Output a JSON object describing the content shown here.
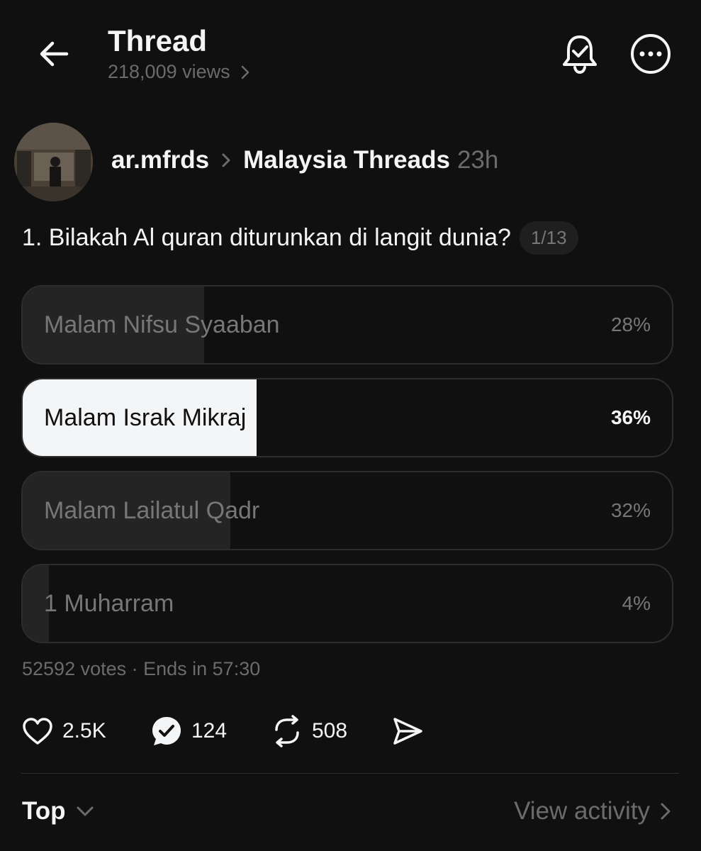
{
  "header": {
    "title": "Thread",
    "views": "218,009 views"
  },
  "post": {
    "username": "ar.mfrds",
    "community": "Malaysia Threads",
    "time": "23h",
    "question": "1. Bilakah Al quran diturunkan di langit dunia?",
    "counter": "1/13"
  },
  "poll": {
    "options": [
      {
        "label": "Malam Nifsu Syaaban",
        "percent": "28%",
        "share": 0.28
      },
      {
        "label": "Malam Israk Mikraj",
        "percent": "36%",
        "share": 0.36,
        "selected": true
      },
      {
        "label": "Malam Lailatul Qadr",
        "percent": "32%",
        "share": 0.32
      },
      {
        "label": "1 Muharram",
        "percent": "4%",
        "share": 0.04
      }
    ],
    "meta": "52592 votes · Ends in 57:30"
  },
  "actions": {
    "likes": "2.5K",
    "replies": "124",
    "reposts": "508"
  },
  "footer": {
    "sort": "Top",
    "view_activity": "View activity"
  },
  "colors": {
    "background": "#101010",
    "text": "#f3f5f7",
    "muted": "#6b6b6b",
    "bar": "#242424",
    "selected_bar": "#f3f5f7"
  },
  "icons": [
    "back-arrow-icon",
    "chevron-right-icon",
    "bell-check-icon",
    "more-icon",
    "heart-icon",
    "reply-icon",
    "repost-icon",
    "share-icon",
    "chevron-down-icon"
  ]
}
